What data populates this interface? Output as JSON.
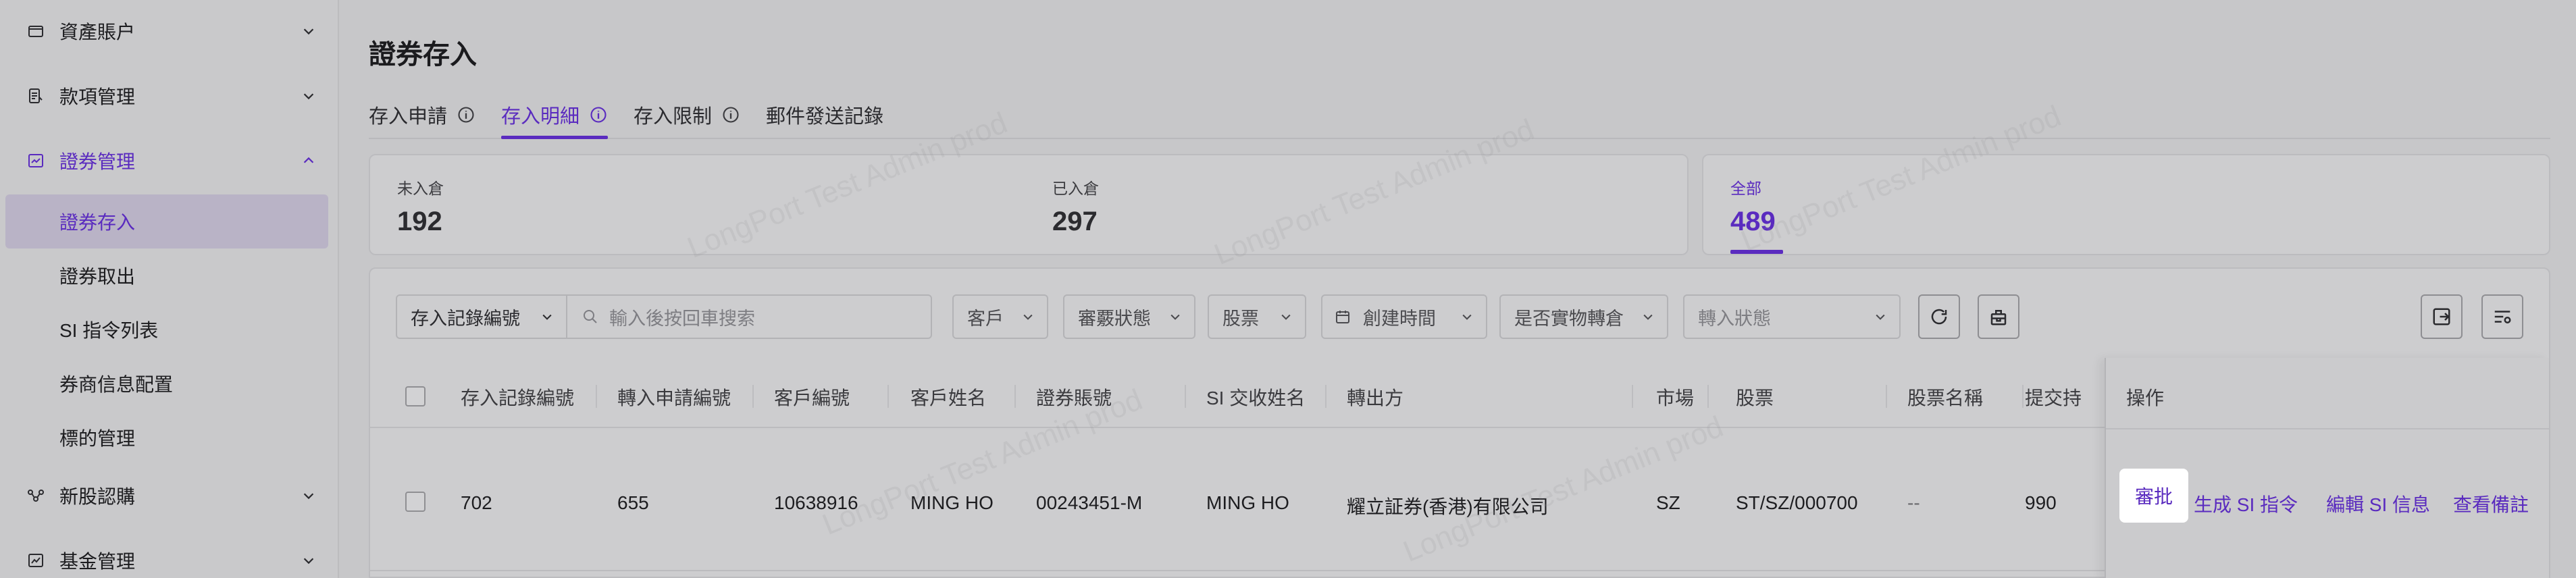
{
  "sidebar": {
    "items": [
      {
        "label": "資產賬户",
        "icon": "wallet-icon"
      },
      {
        "label": "款項管理",
        "icon": "ledger-icon"
      },
      {
        "label": "證券管理",
        "icon": "chart-box-icon"
      },
      {
        "label": "新股認購",
        "icon": "nodes-icon"
      },
      {
        "label": "基金管理",
        "icon": "fund-chart-icon"
      }
    ],
    "sub_items": [
      "證券存入",
      "證券取出",
      "SI 指令列表",
      "券商信息配置",
      "標的管理"
    ]
  },
  "page": {
    "title": "證券存入",
    "tabs": [
      "存入申請",
      "存入明細",
      "存入限制",
      "郵件發送記錄"
    ]
  },
  "stats": {
    "pending_label": "未入倉",
    "pending_value": "192",
    "done_label": "已入倉",
    "done_value": "297",
    "all_label": "全部",
    "all_value": "489"
  },
  "filters": {
    "field_select": "存入記錄編號",
    "search_placeholder": "輸入後按回車搜索",
    "customer": "客戶",
    "review_status": "審覈狀態",
    "stock": "股票",
    "create_time": "創建時間",
    "physical": "是否實物轉倉",
    "transfer_status": "轉入狀態"
  },
  "table": {
    "headers": [
      "存入記錄編號",
      "轉入申請編號",
      "客戶編號",
      "客戶姓名",
      "證券賬號",
      "SI 交收姓名",
      "轉出方",
      "市場",
      "股票",
      "股票名稱",
      "提交持",
      "操作"
    ],
    "row": {
      "record_no": "702",
      "apply_no": "655",
      "customer_no": "10638916",
      "customer_name": "MING HO",
      "account": "00243451-M",
      "si_name": "MING HO",
      "transfer_out": "耀立証券(香港)有限公司",
      "market": "SZ",
      "stock": "ST/SZ/000700",
      "stock_name": "--",
      "submitted": "990"
    },
    "ops": [
      "審批",
      "生成 SI 指令",
      "編輯 SI 信息",
      "查看備註"
    ]
  },
  "watermark": "LongPort Test Admin prod",
  "colors": {
    "accent": "#5a2bbf",
    "background": "#c7c7c9"
  }
}
